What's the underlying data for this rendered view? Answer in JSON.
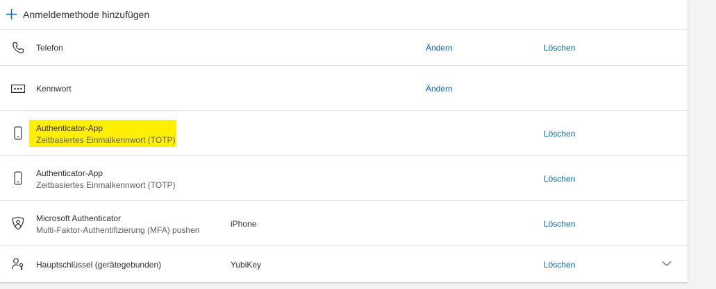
{
  "add_method": {
    "label": "Anmeldemethode hinzufügen",
    "icon": "plus-icon"
  },
  "methods": [
    {
      "icon": "phone-icon",
      "title": "Telefon",
      "change": "Ändern",
      "delete": "Löschen"
    },
    {
      "icon": "password-icon",
      "title": "Kennwort",
      "change": "Ändern"
    },
    {
      "icon": "mobile-device-icon",
      "title": "Authenticator-App",
      "subtitle": "Zeitbasiertes Einmalkennwort (TOTP)",
      "delete": "Löschen",
      "highlighted": true
    },
    {
      "icon": "mobile-device-icon",
      "title": "Authenticator-App",
      "subtitle": "Zeitbasiertes Einmalkennwort (TOTP)",
      "delete": "Löschen"
    },
    {
      "icon": "microsoft-authenticator-icon",
      "title": "Microsoft Authenticator",
      "subtitle": "Multi-Faktor-Authentifizierung (MFA) pushen",
      "detail": "iPhone",
      "delete": "Löschen"
    },
    {
      "icon": "security-key-icon",
      "title": "Hauptschlüssel (gerätegebunden)",
      "detail": "YubiKey",
      "delete": "Löschen",
      "expand_icon": "chevron-down-icon"
    }
  ],
  "colors": {
    "link": "#0067b8",
    "highlight": "#ffef00",
    "text": "#323130",
    "subtext": "#605e5c",
    "divider": "#e5e5e5",
    "background": "#f3f3f3"
  }
}
